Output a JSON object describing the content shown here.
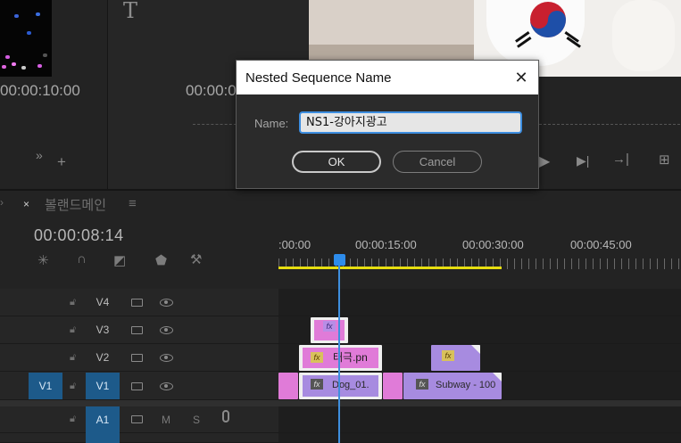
{
  "source_monitor": {
    "timecode_left": "00:00:10:00",
    "timecode_mid": "00:00:0",
    "text_tool_glyph": "T"
  },
  "timeline": {
    "tab_title": "볼랜드메인",
    "close_glyph": "×",
    "menu_glyph": "≡",
    "timecode": "00:00:08:14",
    "ruler_labels": [
      ":00:00",
      "00:00:15:00",
      "00:00:30:00",
      "00:00:45:00"
    ],
    "tracks": {
      "v4": "V4",
      "v3": "V3",
      "v2": "V2",
      "v1_source": "V1",
      "v1": "V1",
      "a1": "A1",
      "mute": "M",
      "solo": "S"
    },
    "clips": {
      "fx_label": "fx",
      "taeguk": "태극.pn",
      "dog": "Dog_01.",
      "subway": "Subway - 100"
    }
  },
  "dialog": {
    "title": "Nested Sequence Name",
    "close_glyph": "✕",
    "name_label": "Name:",
    "name_value": "NS1-강아지광고",
    "ok_label": "OK",
    "cancel_label": "Cancel"
  },
  "colors": {
    "accent_blue": "#2d8ceb",
    "work_area_yellow": "#e6dd10",
    "clip_purple": "#a78be0",
    "clip_pink": "#e07bd8"
  }
}
